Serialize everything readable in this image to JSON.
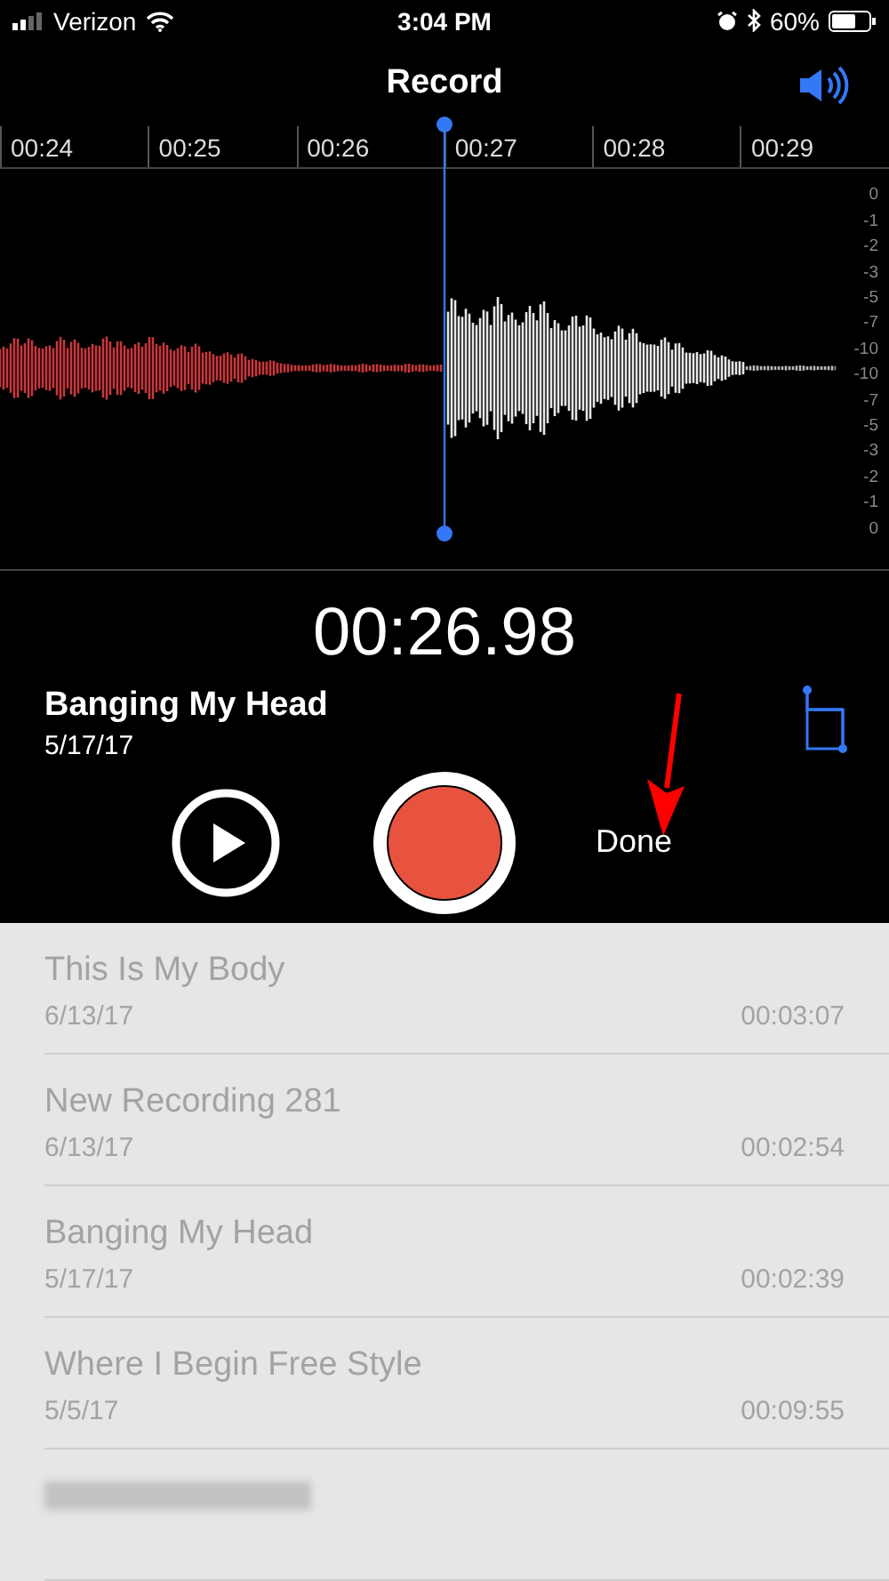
{
  "status_bar": {
    "carrier": "Verizon",
    "time": "3:04 PM",
    "battery": "60%"
  },
  "header": {
    "title": "Record"
  },
  "timeline": {
    "ticks": [
      "00:24",
      "00:25",
      "00:26",
      "00:27",
      "00:28",
      "00:29"
    ]
  },
  "db_scale": [
    "0",
    "-1",
    "-2",
    "-3",
    "-5",
    "-7",
    "-10",
    "-10",
    "-7",
    "-5",
    "-3",
    "-2",
    "-1",
    "0"
  ],
  "timer": "00:26.98",
  "current": {
    "title": "Banging My Head",
    "date": "5/17/17"
  },
  "done_button": "Done",
  "recordings": [
    {
      "kind": "item",
      "title": "This Is My Body",
      "date": "6/13/17",
      "duration": "00:03:07"
    },
    {
      "kind": "item",
      "title": "New Recording 281",
      "date": "6/13/17",
      "duration": "00:02:54"
    },
    {
      "kind": "item",
      "title": "Banging My Head",
      "date": "5/17/17",
      "duration": "00:02:39"
    },
    {
      "kind": "item",
      "title": "Where I Begin Free Style",
      "date": "5/5/17",
      "duration": "00:09:55"
    },
    {
      "kind": "blurred"
    }
  ]
}
